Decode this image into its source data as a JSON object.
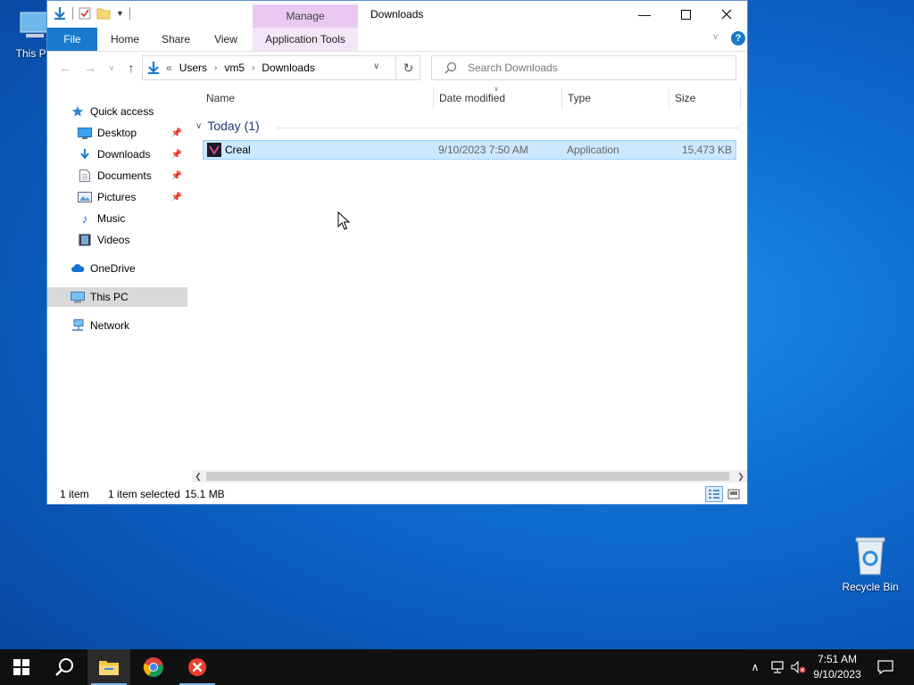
{
  "desktop": {
    "this_pc_label": "This PC",
    "recycle_bin_label": "Recycle Bin"
  },
  "window": {
    "title": "Downloads",
    "manage_tab": "Manage",
    "ribbon_tabs": {
      "file": "File",
      "home": "Home",
      "share": "Share",
      "view": "View",
      "app_tools": "Application Tools"
    },
    "address": {
      "overflow": "«",
      "crumbs": [
        "Users",
        "vm5",
        "Downloads"
      ]
    },
    "search_placeholder": "Search Downloads",
    "sidebar": [
      {
        "label": "Quick access",
        "icon": "star-icon"
      },
      {
        "label": "Desktop",
        "icon": "desktop-icon",
        "pinned": true
      },
      {
        "label": "Downloads",
        "icon": "download-arrow-icon",
        "pinned": true
      },
      {
        "label": "Documents",
        "icon": "documents-icon",
        "pinned": true
      },
      {
        "label": "Pictures",
        "icon": "pictures-icon",
        "pinned": true
      },
      {
        "label": "Music",
        "icon": "music-icon"
      },
      {
        "label": "Videos",
        "icon": "videos-icon"
      },
      {
        "label": "OneDrive",
        "icon": "cloud-icon"
      },
      {
        "label": "This PC",
        "icon": "computer-icon",
        "selected": true
      },
      {
        "label": "Network",
        "icon": "network-icon"
      }
    ],
    "columns": {
      "name": "Name",
      "date": "Date modified",
      "type": "Type",
      "size": "Size"
    },
    "group_label": "Today (1)",
    "files": [
      {
        "name": "Creal",
        "date": "9/10/2023 7:50 AM",
        "type": "Application",
        "size": "15,473 KB"
      }
    ],
    "status": {
      "count": "1 item",
      "selected": "1 item selected",
      "size": "15.1 MB"
    }
  },
  "taskbar": {
    "time": "7:51 AM",
    "date": "9/10/2023"
  },
  "colors": {
    "accent": "#1979ca",
    "selection": "#cce8ff",
    "manage_tab": "#e9c9f2"
  }
}
